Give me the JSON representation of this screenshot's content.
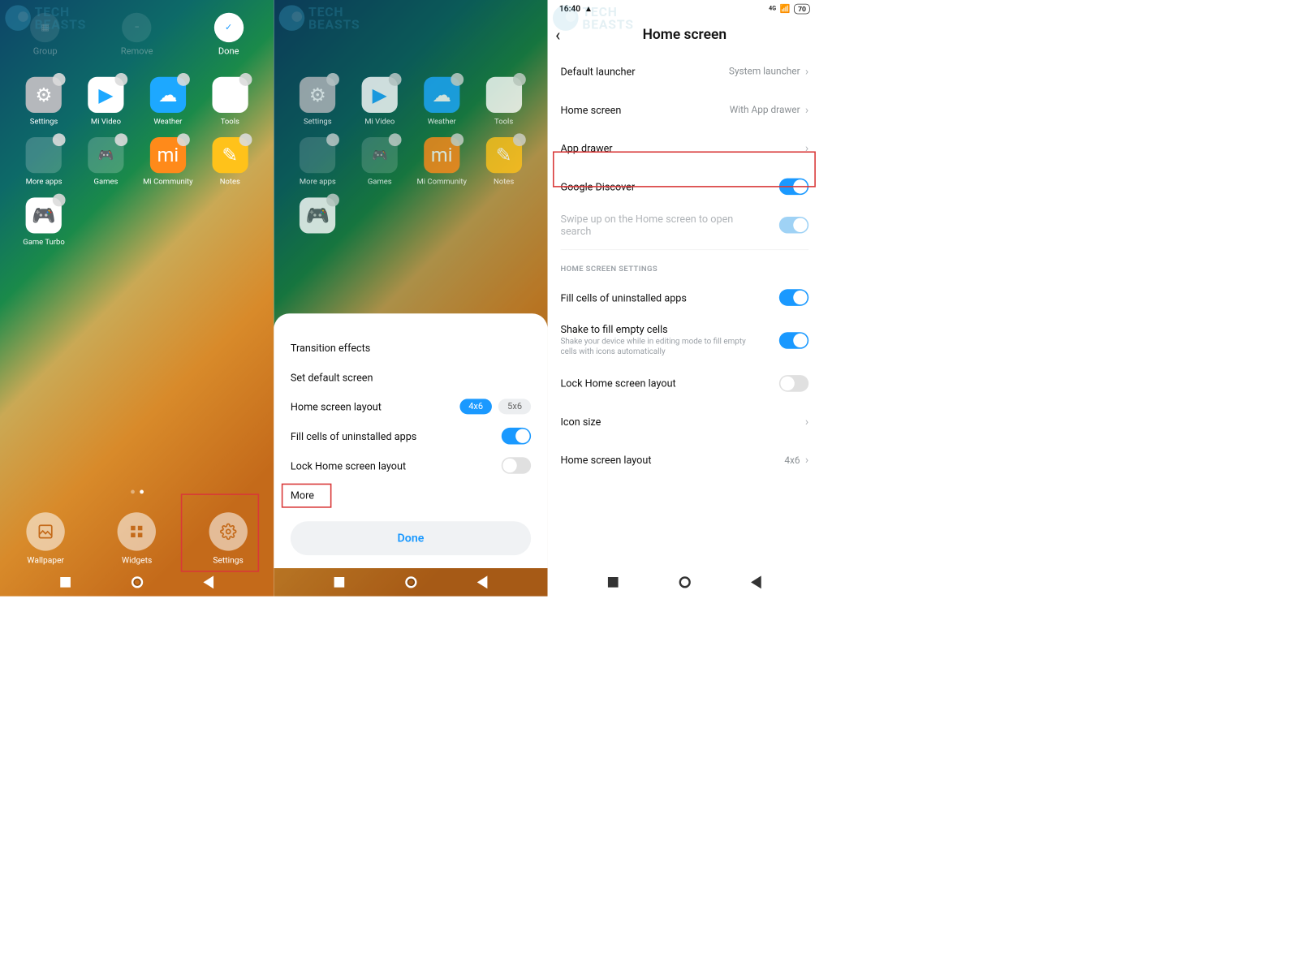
{
  "watermark_top": "TECH",
  "watermark_bottom": "BEASTS",
  "panel1": {
    "topbar": {
      "group": "Group",
      "remove": "Remove",
      "done": "Done"
    },
    "apps": {
      "settings": "Settings",
      "mi_video": "Mi Video",
      "weather": "Weather",
      "tools": "Tools",
      "more_apps": "More apps",
      "games": "Games",
      "mi_community": "Mi Community",
      "notes": "Notes",
      "game_turbo": "Game Turbo"
    },
    "bottombar": {
      "wallpaper": "Wallpaper",
      "widgets": "Widgets",
      "settings": "Settings"
    }
  },
  "panel2": {
    "apps": {
      "settings": "Settings",
      "mi_video": "Mi Video",
      "weather": "Weather",
      "tools": "Tools",
      "more_apps": "More apps",
      "games": "Games",
      "mi_community": "Mi Community",
      "notes": "Notes"
    },
    "sheet": {
      "transition": "Transition effects",
      "default_screen": "Set default screen",
      "layout": "Home screen layout",
      "layout_opt1": "4x6",
      "layout_opt2": "5x6",
      "fill_cells": "Fill cells of uninstalled apps",
      "lock_layout": "Lock Home screen layout",
      "more": "More",
      "done": "Done"
    }
  },
  "panel3": {
    "status_time": "16:40",
    "status_batt": "70",
    "status_net": "4G",
    "title": "Home screen",
    "rows": {
      "default_launcher": "Default launcher",
      "default_launcher_val": "System launcher",
      "home_screen": "Home screen",
      "home_screen_val": "With App drawer",
      "app_drawer": "App drawer",
      "google_discover": "Google Discover",
      "swipe_up": "Swipe up on the Home screen to open search",
      "section": "HOME SCREEN SETTINGS",
      "fill_cells": "Fill cells of uninstalled apps",
      "shake": "Shake to fill empty cells",
      "shake_sub": "Shake your device while in editing mode to fill empty cells with icons automatically",
      "lock_layout": "Lock Home screen layout",
      "icon_size": "Icon size",
      "layout": "Home screen layout",
      "layout_val": "4x6"
    }
  }
}
